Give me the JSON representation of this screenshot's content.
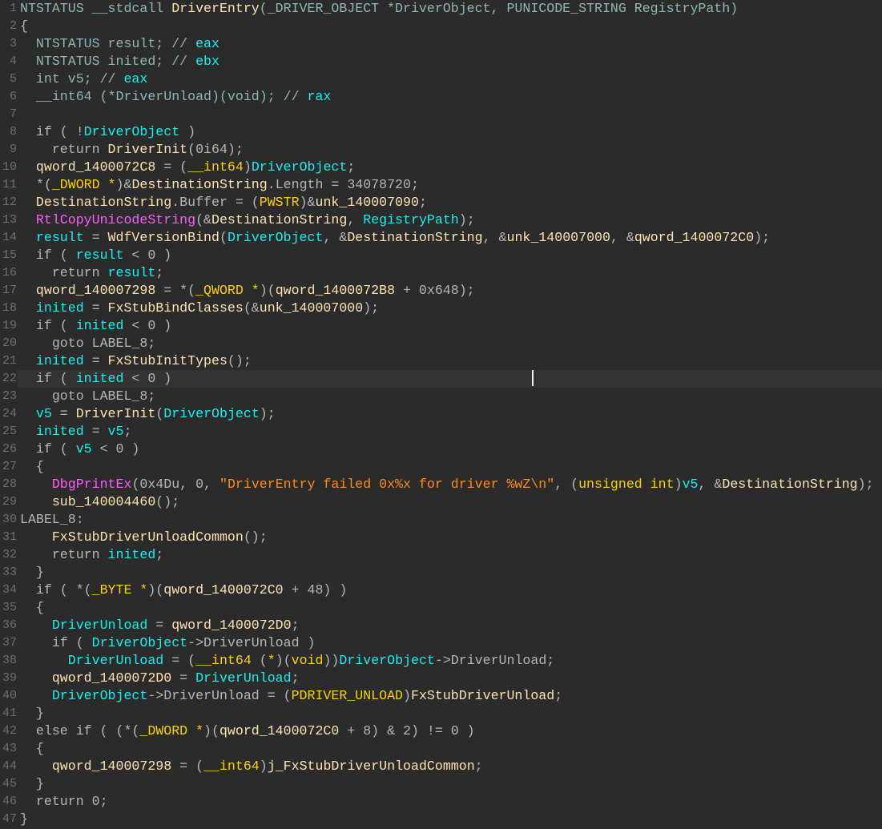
{
  "colors": {
    "background": "#2b2b2b",
    "default": "#b6b6b6",
    "declaration": "#92b6b6",
    "local_variable": "#16f0f0",
    "global_name": "#ffe3b0",
    "type": "#ffd100",
    "library_function": "#ff5cff",
    "string": "#ff8a1c",
    "line_number": "#707070"
  },
  "cursor_line": 22,
  "lines": [
    [
      [
        "t",
        "NTSTATUS __stdcall "
      ],
      [
        "g",
        "DriverEntry"
      ],
      [
        "t",
        "(_DRIVER_OBJECT *DriverObject, PUNICODE_STRING RegistryPath)"
      ]
    ],
    [
      [
        "d",
        "{"
      ]
    ],
    [
      [
        "t",
        "  NTSTATUS result; // "
      ],
      [
        "v",
        "eax"
      ]
    ],
    [
      [
        "t",
        "  NTSTATUS inited; // "
      ],
      [
        "v",
        "ebx"
      ]
    ],
    [
      [
        "t",
        "  int v5; // "
      ],
      [
        "v",
        "eax"
      ]
    ],
    [
      [
        "t",
        "  __int64 (*DriverUnload)(void); // "
      ],
      [
        "v",
        "rax"
      ]
    ],
    [],
    [
      [
        "d",
        "  if ( !"
      ],
      [
        "v",
        "DriverObject"
      ],
      [
        "d",
        " )"
      ]
    ],
    [
      [
        "d",
        "    return "
      ],
      [
        "g",
        "DriverInit"
      ],
      [
        "d",
        "(0i64);"
      ]
    ],
    [
      [
        "d",
        "  "
      ],
      [
        "g",
        "qword_1400072C8"
      ],
      [
        "d",
        " = ("
      ],
      [
        "y",
        "__int64"
      ],
      [
        "d",
        ")"
      ],
      [
        "v",
        "DriverObject"
      ],
      [
        "d",
        ";"
      ]
    ],
    [
      [
        "d",
        "  *("
      ],
      [
        "y",
        "_DWORD *"
      ],
      [
        "d",
        ")&"
      ],
      [
        "g",
        "DestinationString"
      ],
      [
        "d",
        ".Length = 34078720;"
      ]
    ],
    [
      [
        "d",
        "  "
      ],
      [
        "g",
        "DestinationString"
      ],
      [
        "d",
        ".Buffer = ("
      ],
      [
        "y",
        "PWSTR"
      ],
      [
        "d",
        ")&"
      ],
      [
        "g",
        "unk_140007090"
      ],
      [
        "d",
        ";"
      ]
    ],
    [
      [
        "d",
        "  "
      ],
      [
        "m",
        "RtlCopyUnicodeString"
      ],
      [
        "d",
        "(&"
      ],
      [
        "g",
        "DestinationString"
      ],
      [
        "d",
        ", "
      ],
      [
        "v",
        "RegistryPath"
      ],
      [
        "d",
        ");"
      ]
    ],
    [
      [
        "d",
        "  "
      ],
      [
        "v",
        "result"
      ],
      [
        "d",
        " = "
      ],
      [
        "g",
        "WdfVersionBind"
      ],
      [
        "d",
        "("
      ],
      [
        "v",
        "DriverObject"
      ],
      [
        "d",
        ", &"
      ],
      [
        "g",
        "DestinationString"
      ],
      [
        "d",
        ", &"
      ],
      [
        "g",
        "unk_140007000"
      ],
      [
        "d",
        ", &"
      ],
      [
        "g",
        "qword_1400072C0"
      ],
      [
        "d",
        ");"
      ]
    ],
    [
      [
        "d",
        "  if ( "
      ],
      [
        "v",
        "result"
      ],
      [
        "d",
        " < 0 )"
      ]
    ],
    [
      [
        "d",
        "    return "
      ],
      [
        "v",
        "result"
      ],
      [
        "d",
        ";"
      ]
    ],
    [
      [
        "d",
        "  "
      ],
      [
        "g",
        "qword_140007298"
      ],
      [
        "d",
        " = *("
      ],
      [
        "y",
        "_QWORD *"
      ],
      [
        "d",
        ")("
      ],
      [
        "g",
        "qword_1400072B8"
      ],
      [
        "d",
        " + 0x648);"
      ]
    ],
    [
      [
        "d",
        "  "
      ],
      [
        "v",
        "inited"
      ],
      [
        "d",
        " = "
      ],
      [
        "g",
        "FxStubBindClasses"
      ],
      [
        "d",
        "(&"
      ],
      [
        "g",
        "unk_140007000"
      ],
      [
        "d",
        ");"
      ]
    ],
    [
      [
        "d",
        "  if ( "
      ],
      [
        "v",
        "inited"
      ],
      [
        "d",
        " < 0 )"
      ]
    ],
    [
      [
        "d",
        "    goto LABEL_8;"
      ]
    ],
    [
      [
        "d",
        "  "
      ],
      [
        "v",
        "inited"
      ],
      [
        "d",
        " = "
      ],
      [
        "g",
        "FxStubInitTypes"
      ],
      [
        "d",
        "();"
      ]
    ],
    [
      [
        "d",
        "  if ( "
      ],
      [
        "v",
        "inited"
      ],
      [
        "d",
        " < 0 )"
      ]
    ],
    [
      [
        "d",
        "    goto LABEL_8;"
      ]
    ],
    [
      [
        "d",
        "  "
      ],
      [
        "v",
        "v5"
      ],
      [
        "d",
        " = "
      ],
      [
        "g",
        "DriverInit"
      ],
      [
        "d",
        "("
      ],
      [
        "v",
        "DriverObject"
      ],
      [
        "d",
        ");"
      ]
    ],
    [
      [
        "d",
        "  "
      ],
      [
        "v",
        "inited"
      ],
      [
        "d",
        " = "
      ],
      [
        "v",
        "v5"
      ],
      [
        "d",
        ";"
      ]
    ],
    [
      [
        "d",
        "  if ( "
      ],
      [
        "v",
        "v5"
      ],
      [
        "d",
        " < 0 )"
      ]
    ],
    [
      [
        "d",
        "  {"
      ]
    ],
    [
      [
        "d",
        "    "
      ],
      [
        "m",
        "DbgPrintEx"
      ],
      [
        "d",
        "(0x4Du, 0, "
      ],
      [
        "s",
        "\"DriverEntry failed 0x%x for driver %wZ\\n\""
      ],
      [
        "d",
        ", ("
      ],
      [
        "y",
        "unsigned int"
      ],
      [
        "d",
        ")"
      ],
      [
        "v",
        "v5"
      ],
      [
        "d",
        ", &"
      ],
      [
        "g",
        "DestinationString"
      ],
      [
        "d",
        ");"
      ]
    ],
    [
      [
        "d",
        "    "
      ],
      [
        "g",
        "sub_140004460"
      ],
      [
        "d",
        "();"
      ]
    ],
    [
      [
        "d",
        "LABEL_8:"
      ]
    ],
    [
      [
        "d",
        "    "
      ],
      [
        "g",
        "FxStubDriverUnloadCommon"
      ],
      [
        "d",
        "();"
      ]
    ],
    [
      [
        "d",
        "    return "
      ],
      [
        "v",
        "inited"
      ],
      [
        "d",
        ";"
      ]
    ],
    [
      [
        "d",
        "  }"
      ]
    ],
    [
      [
        "d",
        "  if ( *("
      ],
      [
        "y",
        "_BYTE *"
      ],
      [
        "d",
        ")("
      ],
      [
        "g",
        "qword_1400072C0"
      ],
      [
        "d",
        " + 48) )"
      ]
    ],
    [
      [
        "d",
        "  {"
      ]
    ],
    [
      [
        "d",
        "    "
      ],
      [
        "v",
        "DriverUnload"
      ],
      [
        "d",
        " = "
      ],
      [
        "g",
        "qword_1400072D0"
      ],
      [
        "d",
        ";"
      ]
    ],
    [
      [
        "d",
        "    if ( "
      ],
      [
        "v",
        "DriverObject"
      ],
      [
        "d",
        "->DriverUnload )"
      ]
    ],
    [
      [
        "d",
        "      "
      ],
      [
        "v",
        "DriverUnload"
      ],
      [
        "d",
        " = ("
      ],
      [
        "y",
        "__int64"
      ],
      [
        "d",
        " ("
      ],
      [
        "y",
        "*"
      ],
      [
        "d",
        ")("
      ],
      [
        "y",
        "void"
      ],
      [
        "d",
        "))"
      ],
      [
        "v",
        "DriverObject"
      ],
      [
        "d",
        "->DriverUnload;"
      ]
    ],
    [
      [
        "d",
        "    "
      ],
      [
        "g",
        "qword_1400072D0"
      ],
      [
        "d",
        " = "
      ],
      [
        "v",
        "DriverUnload"
      ],
      [
        "d",
        ";"
      ]
    ],
    [
      [
        "d",
        "    "
      ],
      [
        "v",
        "DriverObject"
      ],
      [
        "d",
        "->DriverUnload = ("
      ],
      [
        "y",
        "PDRIVER_UNLOAD"
      ],
      [
        "d",
        ")"
      ],
      [
        "g",
        "FxStubDriverUnload"
      ],
      [
        "d",
        ";"
      ]
    ],
    [
      [
        "d",
        "  }"
      ]
    ],
    [
      [
        "d",
        "  else if ( (*("
      ],
      [
        "y",
        "_DWORD *"
      ],
      [
        "d",
        ")("
      ],
      [
        "g",
        "qword_1400072C0"
      ],
      [
        "d",
        " + 8) & 2) != 0 )"
      ]
    ],
    [
      [
        "d",
        "  {"
      ]
    ],
    [
      [
        "d",
        "    "
      ],
      [
        "g",
        "qword_140007298"
      ],
      [
        "d",
        " = ("
      ],
      [
        "y",
        "__int64"
      ],
      [
        "d",
        ")"
      ],
      [
        "g",
        "j_FxStubDriverUnloadCommon"
      ],
      [
        "d",
        ";"
      ]
    ],
    [
      [
        "d",
        "  }"
      ]
    ],
    [
      [
        "d",
        "  return 0;"
      ]
    ],
    [
      [
        "d",
        "}"
      ]
    ]
  ]
}
